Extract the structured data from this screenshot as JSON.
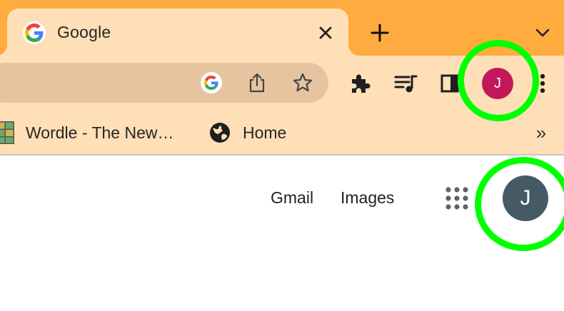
{
  "tab": {
    "title": "Google",
    "favicon_icon": "google-g-icon",
    "close_icon": "close-icon"
  },
  "tabstrip": {
    "new_tab_icon": "plus-icon",
    "tab_search_icon": "chevron-down-icon"
  },
  "toolbar": {
    "omnibox_icons": [
      "google-g-icon",
      "share-icon",
      "star-icon"
    ],
    "buttons": [
      "puzzle-extensions-icon",
      "media-queue-icon",
      "side-panel-icon",
      "kebab-menu-icon"
    ],
    "profile_initial": "J",
    "profile_color": "#C2185B"
  },
  "bookmarks": {
    "items": [
      {
        "label": "Wordle - The New…",
        "icon": "wordle-grid-icon"
      },
      {
        "label": "Home",
        "icon": "globe-icon"
      }
    ],
    "overflow": "»"
  },
  "page": {
    "links": [
      "Gmail",
      "Images"
    ],
    "apps_icon": "apps-grid-icon",
    "account_initial": "J",
    "account_color": "#455A64"
  },
  "colors": {
    "tabstrip_bg": "#FFAB40",
    "toolbar_bg": "#FFDFB8",
    "omnibox_bg": "#E5C49F",
    "highlight": "#00FF00"
  }
}
